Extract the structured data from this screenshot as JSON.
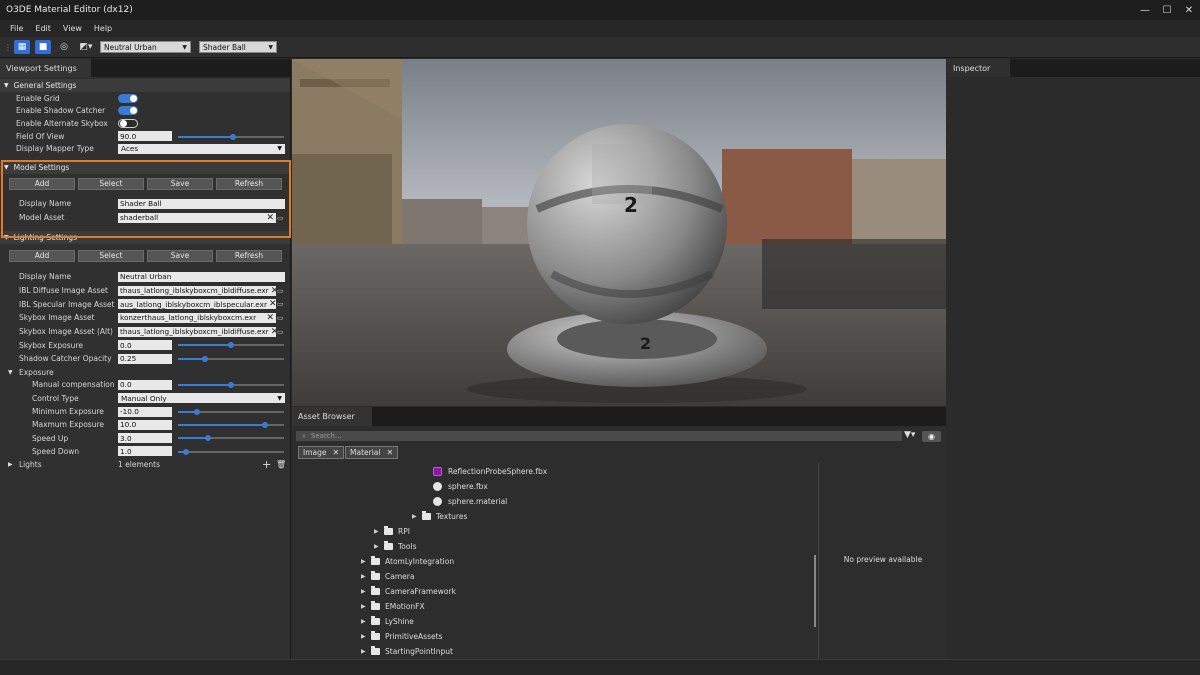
{
  "window": {
    "title": "O3DE Material Editor (dx12)",
    "minimize": "—",
    "maximize": "☐",
    "close": "✕"
  },
  "menu": {
    "file": "File",
    "edit": "Edit",
    "view": "View",
    "help": "Help"
  },
  "toolbar": {
    "lighting_preset": "Neutral Urban",
    "model_preset": "Shader Ball"
  },
  "viewport_settings": {
    "tab": "Viewport Settings",
    "general": {
      "header": "General Settings",
      "enable_grid": {
        "label": "Enable Grid",
        "on": true
      },
      "enable_shadow_catcher": {
        "label": "Enable Shadow Catcher",
        "on": true
      },
      "enable_alt_skybox": {
        "label": "Enable Alternate Skybox",
        "on": false
      },
      "fov": {
        "label": "Field Of View",
        "value": "90.0",
        "slider": 0.52
      },
      "display_mapper": {
        "label": "Display Mapper Type",
        "value": "Aces"
      }
    },
    "model": {
      "header": "Model Settings",
      "buttons": {
        "add": "Add",
        "select": "Select",
        "save": "Save",
        "refresh": "Refresh"
      },
      "display_name": {
        "label": "Display Name",
        "value": "Shader Ball"
      },
      "model_asset": {
        "label": "Model Asset",
        "value": "shaderball"
      }
    },
    "lighting": {
      "header": "Lighting Settings",
      "buttons": {
        "add": "Add",
        "select": "Select",
        "save": "Save",
        "refresh": "Refresh"
      },
      "display_name": {
        "label": "Display Name",
        "value": "Neutral Urban"
      },
      "ibl_diffuse": {
        "label": "IBL Diffuse Image Asset",
        "value": "thaus_latlong_iblskyboxcm_ibldiffuse.exr"
      },
      "ibl_specular": {
        "label": "IBL Specular Image Asset",
        "value": "aus_latlong_iblskyboxcm_iblspecular.exr"
      },
      "skybox": {
        "label": "Skybox Image Asset",
        "value": "konzerthaus_latlong_iblskyboxcm.exr"
      },
      "skybox_alt": {
        "label": "Skybox Image Asset (Alt)",
        "value": "thaus_latlong_iblskyboxcm_ibldiffuse.exr"
      },
      "skybox_exposure": {
        "label": "Skybox Exposure",
        "value": "0.0",
        "slider": 0.5
      },
      "shadow_opacity": {
        "label": "Shadow Catcher Opacity",
        "value": "0.25",
        "slider": 0.25
      }
    },
    "exposure": {
      "header": "Exposure",
      "manual_comp": {
        "label": "Manual compensation",
        "value": "0.0",
        "slider": 0.5
      },
      "control_type": {
        "label": "Control Type",
        "value": "Manual Only"
      },
      "min_exposure": {
        "label": "Minimum Exposure",
        "value": "-10.0",
        "slider": 0.18
      },
      "max_exposure": {
        "label": "Maxmum Exposure",
        "value": "10.0",
        "slider": 0.82
      },
      "speed_up": {
        "label": "Speed Up",
        "value": "3.0",
        "slider": 0.28
      },
      "speed_down": {
        "label": "Speed Down",
        "value": "1.0",
        "slider": 0.08
      }
    },
    "lights": {
      "label": "Lights",
      "value": "1 elements"
    }
  },
  "viewport": {
    "ball_number": "2",
    "ball_number_2": "2"
  },
  "asset_browser": {
    "tab": "Asset Browser",
    "search_placeholder": "Search...",
    "chips": [
      "Image",
      "Material"
    ],
    "tree": [
      {
        "label": "ReflectionProbeSphere.fbx",
        "icon": "material"
      },
      {
        "label": "sphere.fbx",
        "icon": "sphere"
      },
      {
        "label": "sphere.material",
        "icon": "sphere"
      },
      {
        "label": "Textures",
        "icon": "folder"
      },
      {
        "label": "RPI",
        "icon": "folder"
      },
      {
        "label": "Tools",
        "icon": "folder"
      },
      {
        "label": "AtomLyIntegration",
        "icon": "folder"
      },
      {
        "label": "Camera",
        "icon": "folder"
      },
      {
        "label": "CameraFramework",
        "icon": "folder"
      },
      {
        "label": "EMotionFX",
        "icon": "folder"
      },
      {
        "label": "LyShine",
        "icon": "folder"
      },
      {
        "label": "PrimitiveAssets",
        "icon": "folder"
      },
      {
        "label": "StartingPointInput",
        "icon": "folder"
      }
    ],
    "preview": "No preview available"
  },
  "inspector": {
    "tab": "Inspector"
  },
  "colors": {
    "accent": "#3a7bd5",
    "highlight": "#e07b2a"
  }
}
